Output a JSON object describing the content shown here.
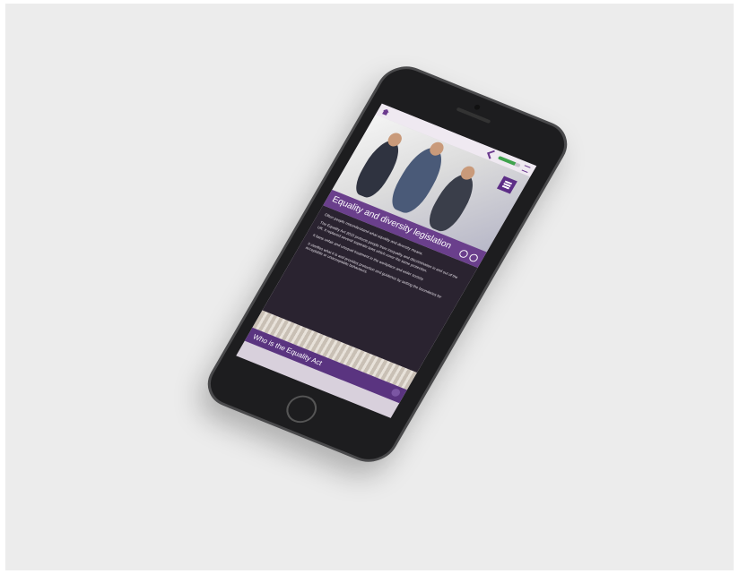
{
  "app": {
    "accent": "#6a3f8c",
    "progress": 0.75
  },
  "topbar": {
    "home_icon": "home-icon",
    "back_icon": "chevron-left-icon",
    "menu_icon": "menu-icon"
  },
  "section": {
    "title": "Equality and diversity legislation",
    "paragraphs": [
      "Often people misunderstand what equality and diversity means.",
      "The Equality Act 2010 protects people from inequality and discrimination in and out of the UK. It replaced several separate laws which cover the same protection.",
      "It bans unfair and unequal treatment in the workplace and wider society.",
      "It clarifies what it is and provides protection and guidance by setting the boundaries for acceptable or unacceptable behaviours."
    ]
  },
  "next_section": {
    "title": "Who is the Equality Act"
  }
}
